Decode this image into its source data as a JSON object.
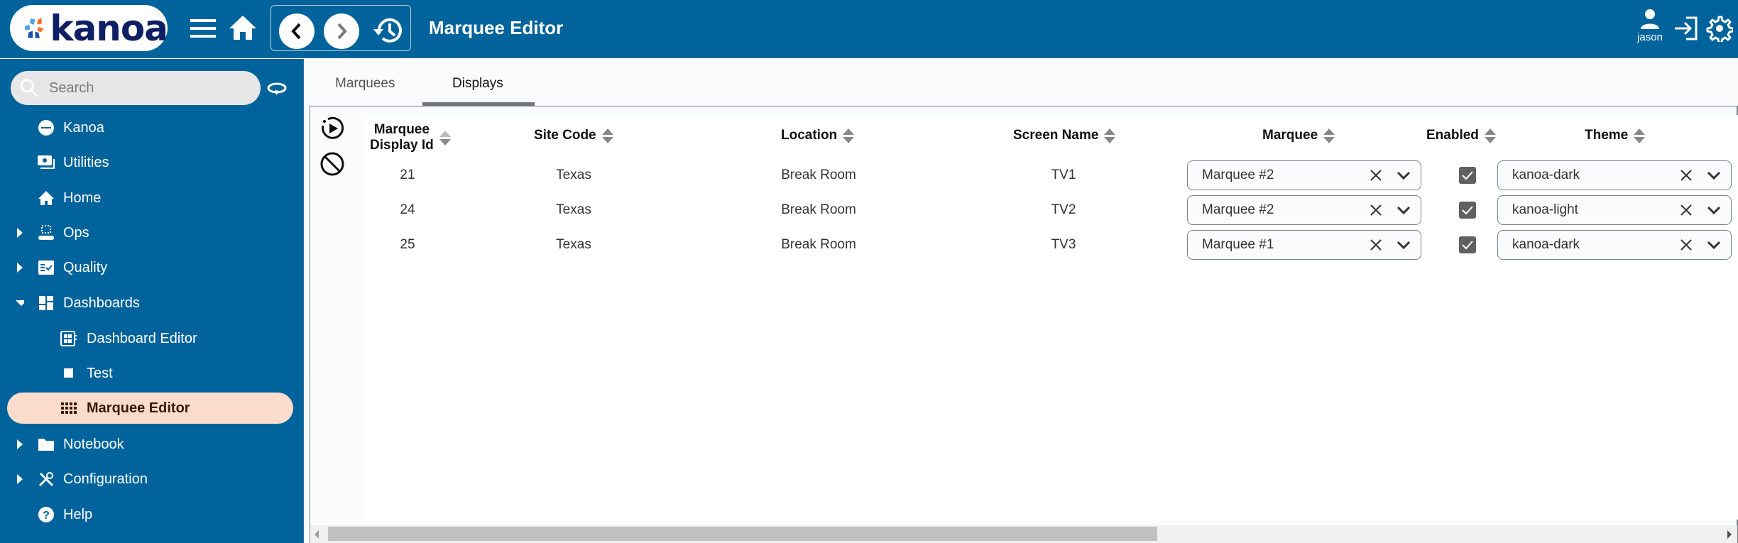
{
  "header": {
    "logo_text": "kanoa",
    "title": "Marquee Editor",
    "user_name": "jason",
    "icons": [
      "menu-icon",
      "home-icon",
      "back-icon",
      "forward-icon",
      "history-icon",
      "user-icon",
      "logout-icon",
      "settings-icon"
    ]
  },
  "sidebar": {
    "search_placeholder": "Search",
    "items": [
      {
        "label": "Kanoa",
        "icon": "kanoa-icon",
        "expandable": false
      },
      {
        "label": "Utilities",
        "icon": "utilities-icon",
        "expandable": false
      },
      {
        "label": "Home",
        "icon": "home-icon",
        "expandable": false
      },
      {
        "label": "Ops",
        "icon": "conveyor-icon",
        "expandable": true,
        "expanded": false
      },
      {
        "label": "Quality",
        "icon": "checklist-icon",
        "expandable": true,
        "expanded": false
      },
      {
        "label": "Dashboards",
        "icon": "dashboard-icon",
        "expandable": true,
        "expanded": true
      },
      {
        "label": "Dashboard Editor",
        "icon": "dashboard-editor-icon",
        "child": true
      },
      {
        "label": "Test",
        "icon": "square-icon",
        "child": true
      },
      {
        "label": "Marquee Editor",
        "icon": "grid-icon",
        "child": true,
        "active": true
      },
      {
        "label": "Notebook",
        "icon": "folder-icon",
        "expandable": true,
        "expanded": false
      },
      {
        "label": "Configuration",
        "icon": "tools-icon",
        "expandable": true,
        "expanded": false
      },
      {
        "label": "Help",
        "icon": "help-icon",
        "expandable": false
      }
    ]
  },
  "tabs": [
    {
      "label": "Marquees",
      "active": false
    },
    {
      "label": "Displays",
      "active": true
    }
  ],
  "table": {
    "columns": [
      {
        "label_line1": "Marquee",
        "label_line2": "Display Id",
        "sort": "ascending"
      },
      {
        "label": "Site Code",
        "sort": "none"
      },
      {
        "label": "Location",
        "sort": "none"
      },
      {
        "label": "Screen Name",
        "sort": "none"
      },
      {
        "label": "Marquee",
        "sort": "none"
      },
      {
        "label": "Enabled",
        "sort": "none"
      },
      {
        "label": "Theme",
        "sort": "none"
      }
    ],
    "rows": [
      {
        "id": "21",
        "site_code": "Texas",
        "location": "Break Room",
        "screen_name": "TV1",
        "marquee": "Marquee #2",
        "enabled": true,
        "theme": "kanoa-dark"
      },
      {
        "id": "24",
        "site_code": "Texas",
        "location": "Break Room",
        "screen_name": "TV2",
        "marquee": "Marquee #2",
        "enabled": true,
        "theme": "kanoa-light"
      },
      {
        "id": "25",
        "site_code": "Texas",
        "location": "Break Room",
        "screen_name": "TV3",
        "marquee": "Marquee #1",
        "enabled": true,
        "theme": "kanoa-dark"
      }
    ],
    "actions": [
      "run-icon",
      "disable-icon"
    ]
  },
  "colors": {
    "header_bg": "#01639b",
    "active_nav_bg": "#fcdccd",
    "logo_dark": "#0f1f63",
    "logo_orange": "#f37021",
    "logo_light_blue": "#4fa3e0",
    "logo_blue": "#1f4fb0"
  }
}
